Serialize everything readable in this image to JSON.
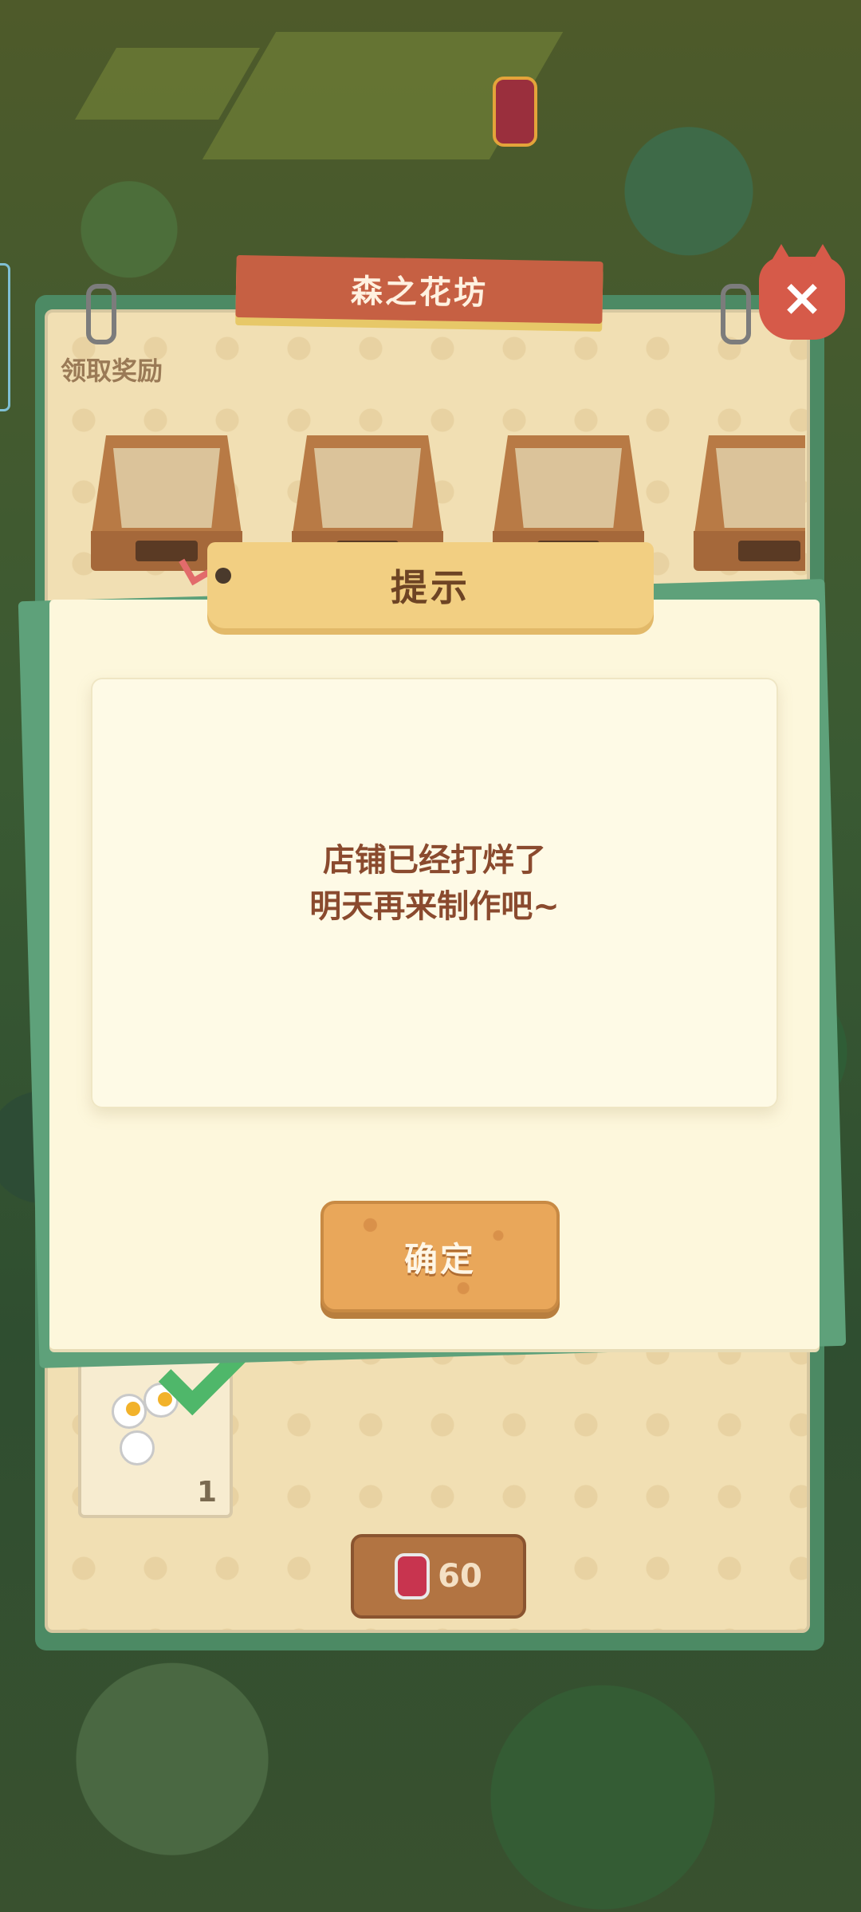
{
  "shop_panel": {
    "title": "森之花坊",
    "close_label": "×",
    "reward_label": "领取奖励",
    "flower_count": "1",
    "cost_value": "60"
  },
  "dialog": {
    "title": "提示",
    "message_line1": "店铺已经打烊了",
    "message_line2": "明天再来制作吧~",
    "confirm_label": "确定"
  },
  "icons": {
    "close": "close-icon",
    "jam_jar": "jam-jar-icon",
    "flower": "white-flower-icon",
    "check": "green-check-icon"
  }
}
